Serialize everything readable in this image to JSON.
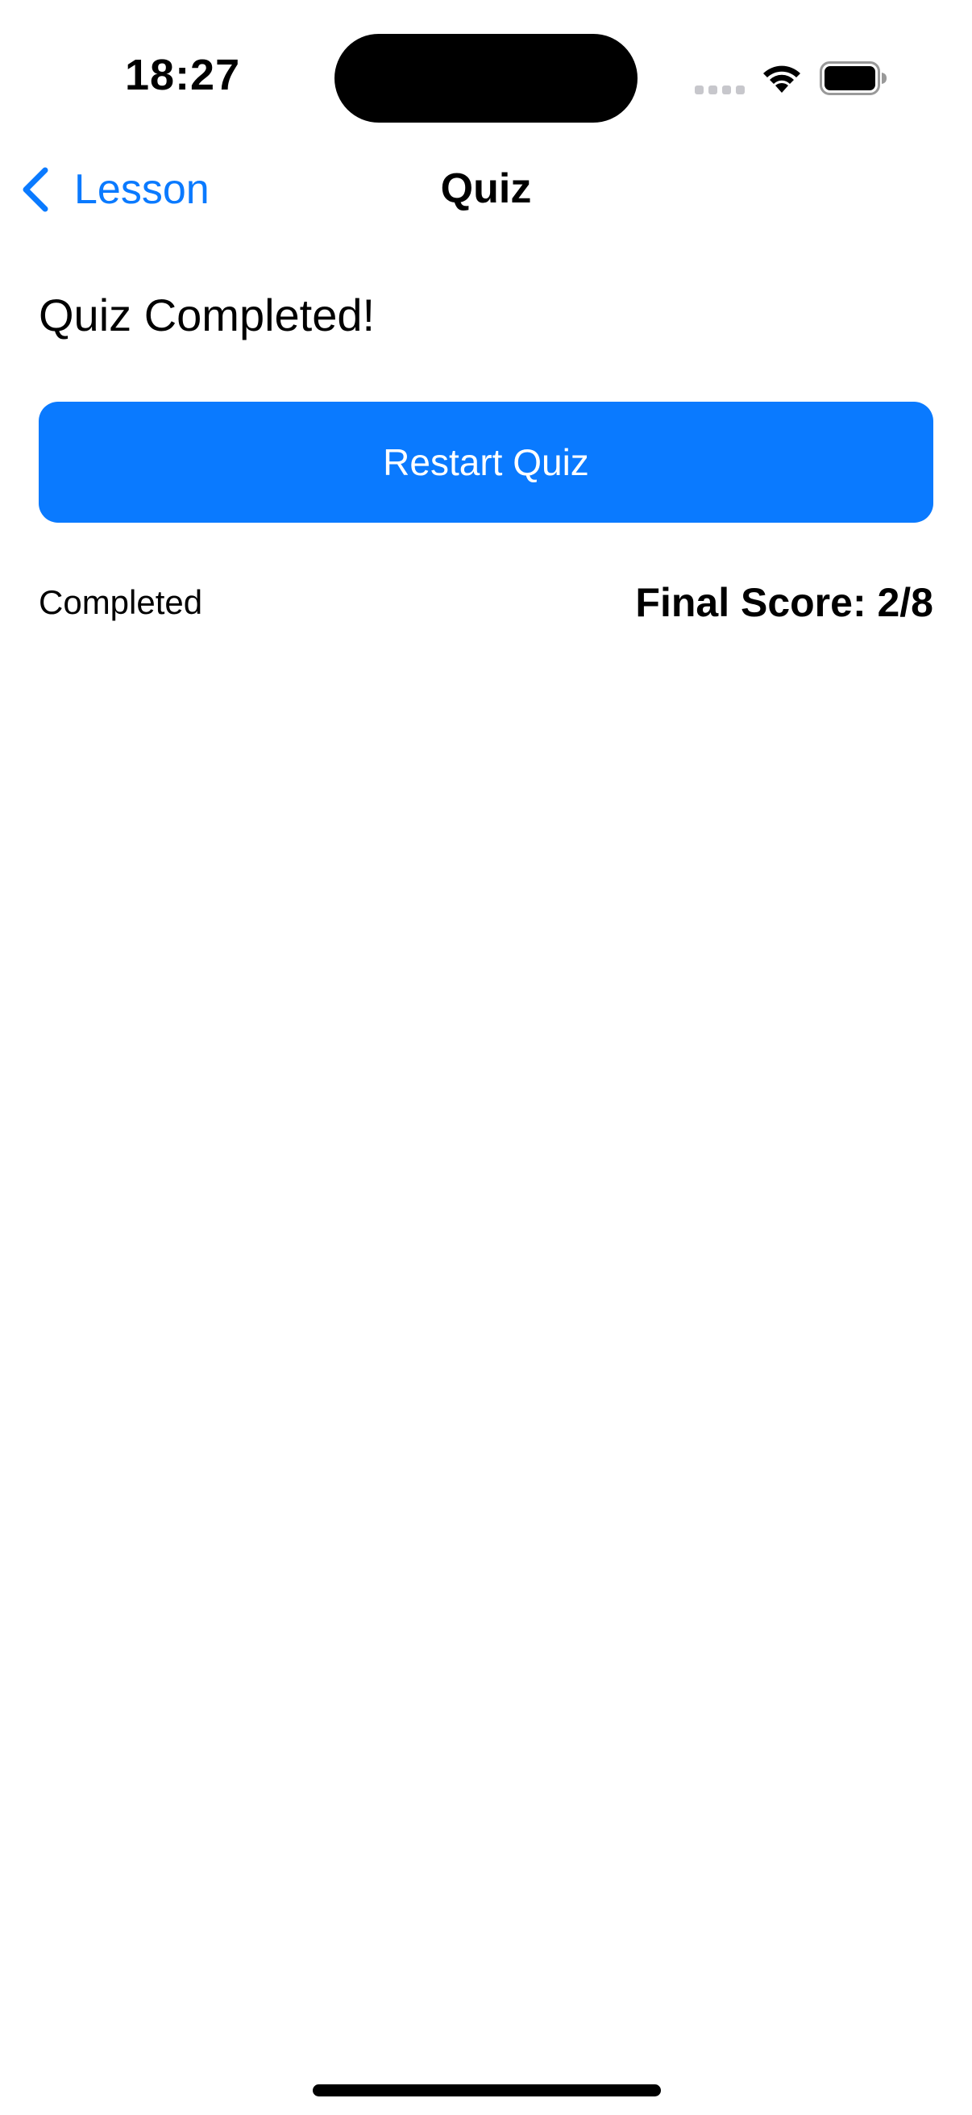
{
  "status_bar": {
    "time": "18:27",
    "icons": [
      "cellular-signal-icon",
      "wifi-icon",
      "battery-icon"
    ]
  },
  "nav": {
    "back_label": "Lesson",
    "back_icon": "chevron-left-icon",
    "title": "Quiz"
  },
  "content": {
    "heading": "Quiz Completed!",
    "restart_label": "Restart Quiz",
    "status": "Completed",
    "final_score": "Final Score: 2/8"
  },
  "colors": {
    "accent": "#0a7aff",
    "background": "#ffffff",
    "text": "#000000"
  }
}
